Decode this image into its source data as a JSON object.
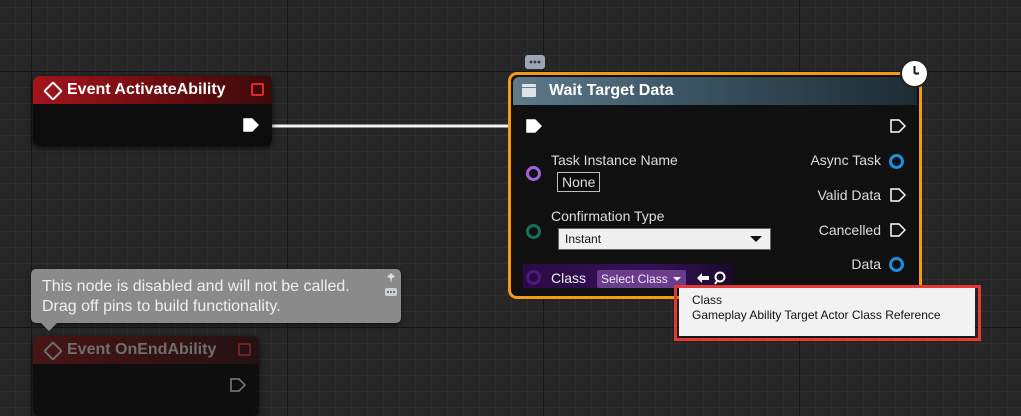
{
  "nodes": {
    "activate": {
      "title": "Event ActivateAbility"
    },
    "end": {
      "title": "Event OnEndAbility"
    },
    "task": {
      "title": "Wait Target Data",
      "inputs": {
        "task_instance_label": "Task Instance Name",
        "task_instance_value": "None",
        "confirmation_label": "Confirmation Type",
        "confirmation_value": "Instant",
        "class_label": "Class",
        "class_value": "Select Class"
      },
      "outputs": {
        "async_task": "Async Task",
        "valid_data": "Valid Data",
        "cancelled": "Cancelled",
        "data": "Data"
      }
    }
  },
  "comment": {
    "line1": "This node is disabled and will not be called.",
    "line2": "Drag off pins to build functionality."
  },
  "tooltip": {
    "title": "Class",
    "description": "Gameplay Ability Target Actor Class Reference"
  },
  "colors": {
    "exec": "#ffffff",
    "object_pin": "#1d8fe0",
    "class_pin": "#a060e0",
    "enum_pin": "#1a6e5e",
    "task_border": "#f39a16",
    "highlight": "#e23838"
  }
}
